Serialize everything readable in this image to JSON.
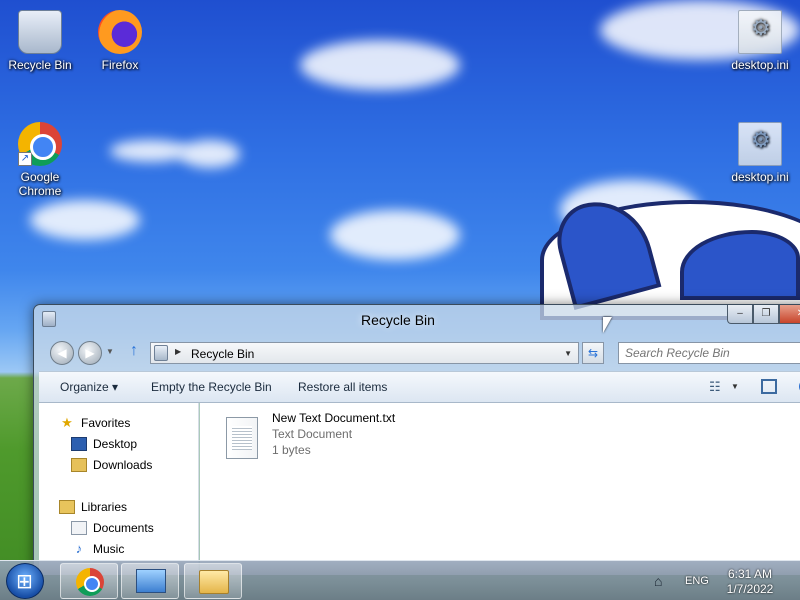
{
  "desktop": {
    "icons": [
      {
        "label": "Recycle Bin",
        "icon": "recycle-bin-icon"
      },
      {
        "label": "Firefox",
        "icon": "firefox-icon"
      },
      {
        "label": "Google Chrome",
        "icon": "chrome-icon"
      },
      {
        "label": "desktop.ini",
        "icon": "settings-file-icon"
      },
      {
        "label": "desktop.ini",
        "icon": "settings-file-icon"
      }
    ]
  },
  "window": {
    "title": "Recycle Bin",
    "controls": {
      "minimize": "‒",
      "maximize": "❐",
      "close": "✕"
    },
    "address": {
      "path": "Recycle Bin"
    },
    "search": {
      "placeholder": "Search Recycle Bin"
    },
    "toolbar": {
      "organize": "Organize ▾",
      "empty": "Empty the Recycle Bin",
      "restore": "Restore all items"
    },
    "nav": {
      "favorites": "Favorites",
      "desktop": "Desktop",
      "downloads": "Downloads",
      "libraries": "Libraries",
      "documents": "Documents",
      "music": "Music"
    },
    "files": [
      {
        "name": "New Text Document.txt",
        "type": "Text Document",
        "size": "1 bytes"
      }
    ]
  },
  "taskbar": {
    "language": "ENG",
    "time": "6:31 AM",
    "date": "1/7/2022"
  },
  "colors": {
    "sky": "#2f6fe3",
    "grass": "#4f9a2c",
    "accent": "#2a73d8"
  }
}
